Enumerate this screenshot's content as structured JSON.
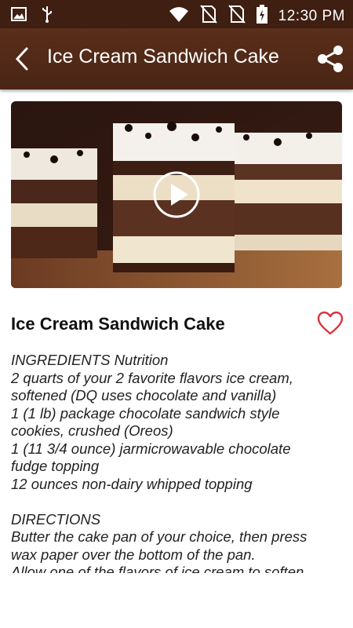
{
  "status_bar": {
    "time": "12:30 PM",
    "icons": [
      "image-icon",
      "usb-icon",
      "wifi-icon",
      "no-sim-icon",
      "no-sim-icon",
      "battery-charging-icon"
    ]
  },
  "app_bar": {
    "title": "Ice Cream Sandwich Cake",
    "back_icon": "chevron-left-icon",
    "share_icon": "share-icon"
  },
  "video": {
    "play_icon": "play-icon"
  },
  "recipe": {
    "title": "Ice Cream Sandwich Cake",
    "favorite_icon": "heart-outline-icon",
    "lines": [
      "INGREDIENTS Nutrition",
      "2 quarts of your 2 favorite flavors ice cream,",
      "softened (DQ uses chocolate and vanilla)",
      "1 (1 lb) package chocolate sandwich style",
      "cookies, crushed (Oreos)",
      "1 (11 3/4 ounce) jarmicrowavable chocolate",
      "fudge topping",
      "12 ounces non-dairy whipped topping",
      "",
      "DIRECTIONS",
      "Butter the cake pan of your choice, then press",
      "wax paper over the bottom of the pan.",
      "Allow one of the flavors of ice cream to soften"
    ]
  },
  "colors": {
    "status_bar": "#3e1f12",
    "app_bar": "#4e2817",
    "accent_heart": "#d9343e"
  }
}
